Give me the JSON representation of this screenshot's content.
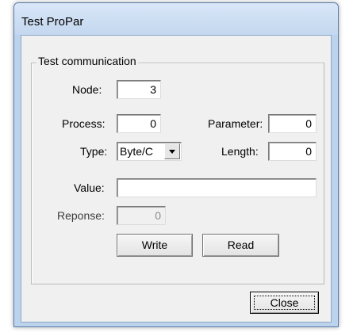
{
  "window": {
    "title": "Test ProPar"
  },
  "group": {
    "title": "Test communication"
  },
  "fields": {
    "node": {
      "label": "Node:",
      "value": "3"
    },
    "process": {
      "label": "Process:",
      "value": "0"
    },
    "parameter": {
      "label": "Parameter:",
      "value": "0"
    },
    "type": {
      "label": "Type:",
      "value": "Byte/C"
    },
    "length": {
      "label": "Length:",
      "value": "0"
    },
    "value": {
      "label": "Value:",
      "value": ""
    },
    "response": {
      "label": "Reponse:",
      "value": "0"
    }
  },
  "buttons": {
    "write": "Write",
    "read": "Read",
    "close": "Close"
  }
}
